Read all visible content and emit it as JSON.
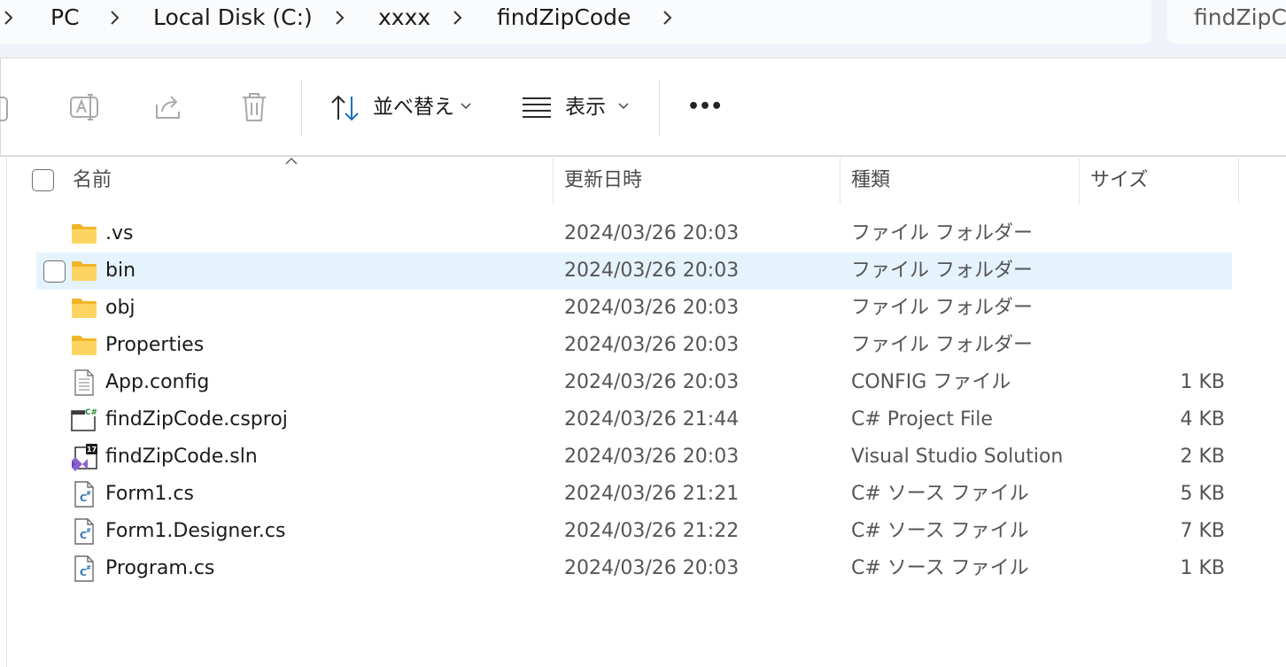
{
  "breadcrumb": {
    "items": [
      "PC",
      "Local Disk (C:)",
      "xxxx",
      "findZipCode"
    ]
  },
  "search": {
    "text": "findZipCo"
  },
  "toolbar": {
    "sort_label": "並べ替え",
    "view_label": "表示",
    "more_label": "•••",
    "icons": [
      "copy-icon",
      "rename-icon",
      "share-icon",
      "delete-icon",
      "sort-icon",
      "view-icon",
      "more-icon"
    ]
  },
  "columns": {
    "name": "名前",
    "modified": "更新日時",
    "type": "種類",
    "size": "サイズ"
  },
  "files": [
    {
      "name": ".vs",
      "modified": "2024/03/26 20:03",
      "type": "ファイル フォルダー",
      "size": "",
      "icon": "folder-icon"
    },
    {
      "name": "bin",
      "modified": "2024/03/26 20:03",
      "type": "ファイル フォルダー",
      "size": "",
      "icon": "folder-icon"
    },
    {
      "name": "obj",
      "modified": "2024/03/26 20:03",
      "type": "ファイル フォルダー",
      "size": "",
      "icon": "folder-icon"
    },
    {
      "name": "Properties",
      "modified": "2024/03/26 20:03",
      "type": "ファイル フォルダー",
      "size": "",
      "icon": "folder-icon"
    },
    {
      "name": "App.config",
      "modified": "2024/03/26 20:03",
      "type": "CONFIG ファイル",
      "size": "1 KB",
      "icon": "config-file-icon"
    },
    {
      "name": "findZipCode.csproj",
      "modified": "2024/03/26 21:44",
      "type": "C# Project File",
      "size": "4 KB",
      "icon": "csproj-file-icon"
    },
    {
      "name": "findZipCode.sln",
      "modified": "2024/03/26 20:03",
      "type": "Visual Studio Solution",
      "size": "2 KB",
      "icon": "sln-file-icon"
    },
    {
      "name": "Form1.cs",
      "modified": "2024/03/26 21:21",
      "type": "C# ソース ファイル",
      "size": "5 KB",
      "icon": "cs-file-icon"
    },
    {
      "name": "Form1.Designer.cs",
      "modified": "2024/03/26 21:22",
      "type": "C# ソース ファイル",
      "size": "7 KB",
      "icon": "cs-file-icon"
    },
    {
      "name": "Program.cs",
      "modified": "2024/03/26 20:03",
      "type": "C# ソース ファイル",
      "size": "1 KB",
      "icon": "cs-file-icon"
    }
  ],
  "selected_row": "bin",
  "colors": {
    "selection": "#e5f3fd",
    "folder": "#f8c93e",
    "accent_blue": "#1a6fc4",
    "vs_purple": "#8a63d2"
  }
}
